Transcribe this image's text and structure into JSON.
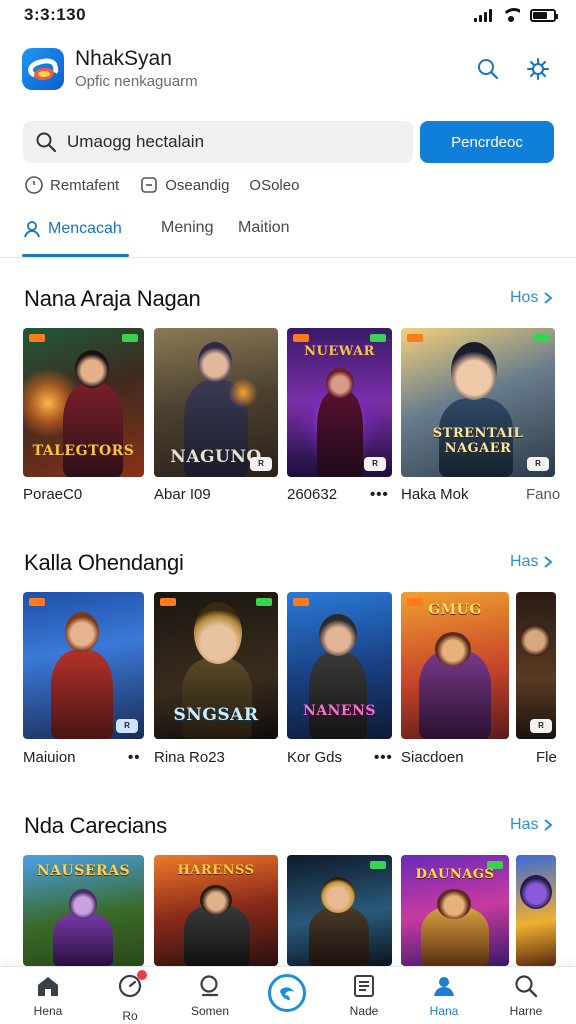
{
  "status_bar": {
    "time": "3:3:130"
  },
  "header": {
    "title": "NhakSyan",
    "subtitle": "Opfic nenkaguarm"
  },
  "search": {
    "value": "Umaogg hectalain",
    "button_label": "Pencrdeoc"
  },
  "filters": [
    "Remtafent",
    "Oseandig",
    "OSoleo"
  ],
  "tabs": [
    "Mencacah",
    "Mening",
    "Maition"
  ],
  "sections": [
    {
      "title": "Nana Araja Nagan",
      "more": "Hos",
      "tiles": [
        {
          "label": "PoraeC0",
          "art_text": "TALEGTORS"
        },
        {
          "label": "Abar I09",
          "art_text": "NAGUNO"
        },
        {
          "label": "260632",
          "art_text": "NUEWAR"
        },
        {
          "label": "Haka Mok",
          "art_text": "STRENTAIL NAGAER"
        },
        {
          "label": "Fano",
          "art_text": ""
        }
      ]
    },
    {
      "title": "Kalla Ohendangi",
      "more": "Has",
      "tiles": [
        {
          "label": "Maiuion",
          "art_text": ""
        },
        {
          "label": "Rina Ro23",
          "art_text": "SNGSAR"
        },
        {
          "label": "Kor Gds",
          "art_text": "NANENS"
        },
        {
          "label": "Siacdoen",
          "art_text": "GMUG"
        },
        {
          "label": "Fle",
          "art_text": ""
        }
      ]
    },
    {
      "title": "Nda Carecians",
      "more": "Has",
      "tiles": [
        {
          "label": "",
          "art_text": "NAUSERAS"
        },
        {
          "label": "",
          "art_text": "HARENSS"
        },
        {
          "label": "",
          "art_text": ""
        },
        {
          "label": "",
          "art_text": "DAUNAGS"
        },
        {
          "label": "",
          "art_text": ""
        }
      ]
    }
  ],
  "bottom_nav": [
    {
      "label": "Hena",
      "icon": "home-icon"
    },
    {
      "label": "Ro",
      "icon": "gauge-icon"
    },
    {
      "label": "Somen",
      "icon": "search-icon"
    },
    {
      "label": "",
      "icon": "brand-icon"
    },
    {
      "label": "Nade",
      "icon": "document-icon"
    },
    {
      "label": "Hana",
      "icon": "person-icon"
    },
    {
      "label": "Harne",
      "icon": "search-icon"
    }
  ],
  "colors": {
    "accent": "#0f7fd9",
    "link": "#2b8fd6"
  }
}
